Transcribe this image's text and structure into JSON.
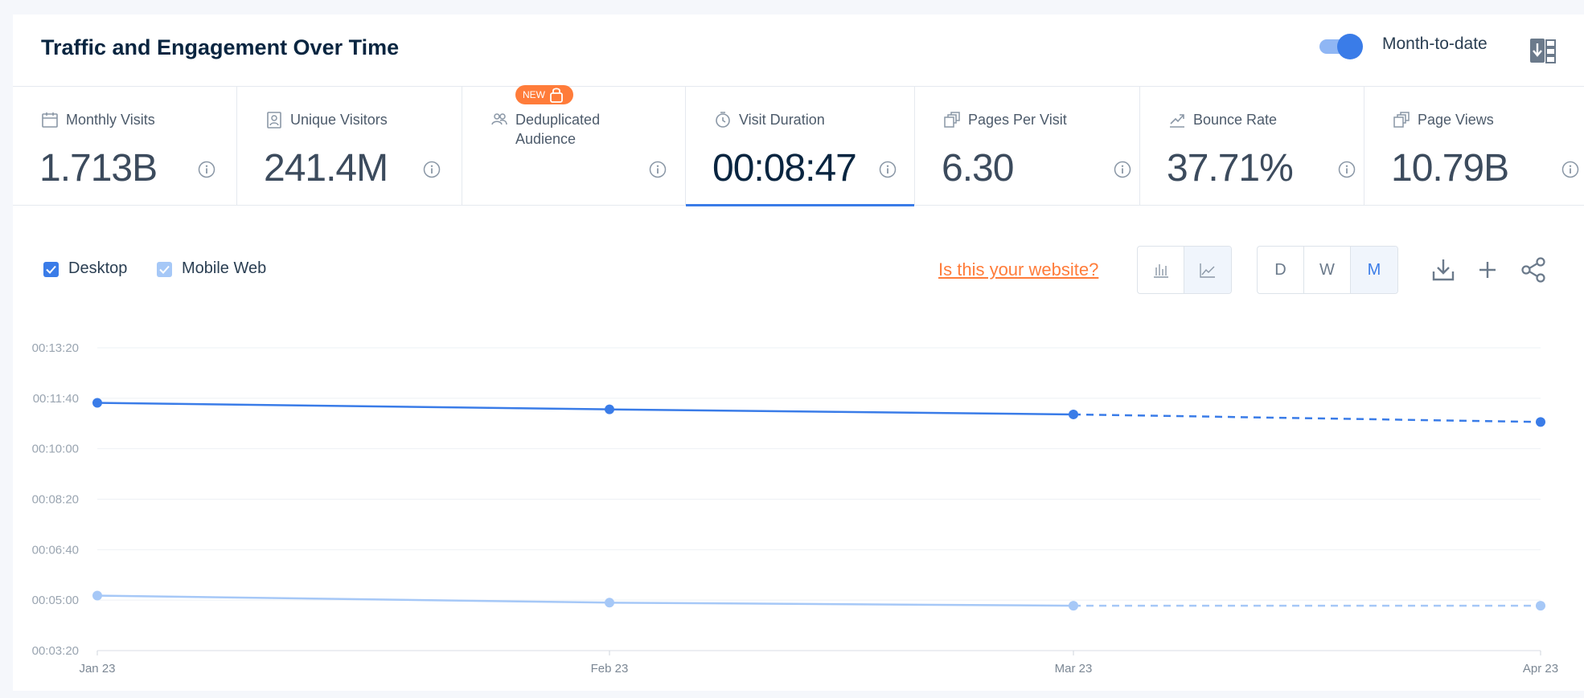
{
  "header": {
    "title": "Traffic and Engagement Over Time",
    "month_to_date_label": "Month-to-date",
    "month_to_date_enabled": true
  },
  "metrics": [
    {
      "label": "Monthly Visits",
      "value": "1.713B",
      "icon": "calendar-icon"
    },
    {
      "label": "Unique Visitors",
      "value": "241.4M",
      "icon": "user-card-icon"
    },
    {
      "label": "Deduplicated Audience",
      "value": "",
      "badge": "NEW",
      "icon": "users-icon"
    },
    {
      "label": "Visit Duration",
      "value": "00:08:47",
      "icon": "stopwatch-icon",
      "active": true
    },
    {
      "label": "Pages Per Visit",
      "value": "6.30",
      "icon": "pages-icon"
    },
    {
      "label": "Bounce Rate",
      "value": "37.71%",
      "icon": "trend-icon"
    },
    {
      "label": "Page Views",
      "value": "10.79B",
      "icon": "pages-icon"
    }
  ],
  "legend": {
    "desktop": "Desktop",
    "mobile": "Mobile Web"
  },
  "controls": {
    "site_link": "Is this your website?",
    "granularity": [
      "D",
      "W",
      "M"
    ],
    "selected_granularity": "M",
    "chart_view": "line"
  },
  "colors": {
    "accent": "#3a7ce8",
    "mobile": "#a6c8f7",
    "orange": "#ff7c3a",
    "title": "#092540"
  },
  "chart_data": {
    "type": "line",
    "categories": [
      "Jan 23",
      "Feb 23",
      "Mar 23",
      "Apr 23"
    ],
    "y_ticks": [
      "00:03:20",
      "00:05:00",
      "00:06:40",
      "00:08:20",
      "00:10:00",
      "00:11:40",
      "00:13:20"
    ],
    "ylim_seconds": [
      200,
      800
    ],
    "series": [
      {
        "name": "Desktop",
        "values_seconds": [
          691,
          678,
          668,
          653
        ],
        "color": "#3a7ce8",
        "projected_from_index": 2
      },
      {
        "name": "Mobile Web",
        "values_seconds": [
          309,
          295,
          289,
          289
        ],
        "color": "#a6c8f7",
        "projected_from_index": 2
      }
    ]
  }
}
